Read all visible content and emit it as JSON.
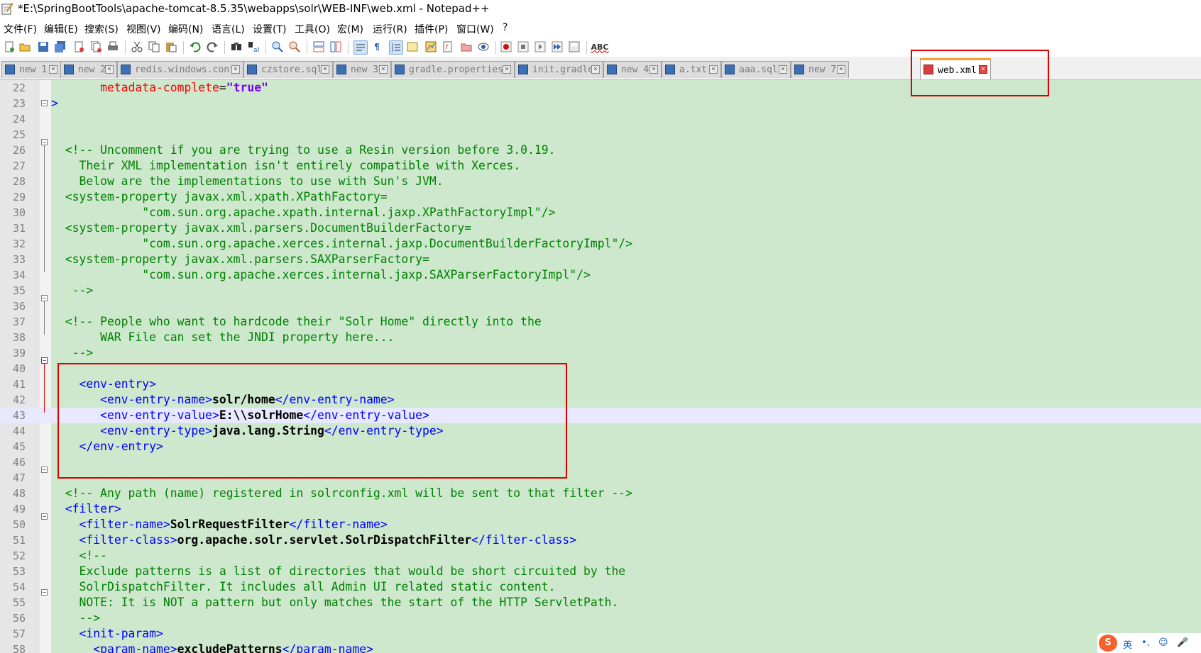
{
  "window": {
    "title": "*E:\\SpringBootTools\\apache-tomcat-8.5.35\\webapps\\solr\\WEB-INF\\web.xml - Notepad++"
  },
  "menu": [
    "文件(F)",
    "编辑(E)",
    "搜索(S)",
    "视图(V)",
    "编码(N)",
    "语言(L)",
    "设置(T)",
    "工具(O)",
    "宏(M)",
    "运行(R)",
    "插件(P)",
    "窗口(W)",
    "?"
  ],
  "toolbar": {
    "icons": [
      "new-file-icon",
      "open-file-icon",
      "save-icon",
      "save-all-icon",
      "close-icon",
      "close-all-icon",
      "print-icon",
      "cut-icon",
      "copy-icon",
      "paste-icon",
      "undo-icon",
      "redo-icon",
      "find-icon",
      "replace-icon",
      "zoom-in-icon",
      "zoom-out-icon",
      "sync-vertical-icon",
      "sync-horizontal-icon",
      "word-wrap-icon",
      "show-all-chars-icon",
      "indent-guide-icon",
      "user-language-icon",
      "document-map-icon",
      "function-list-icon",
      "folder-workspace-icon",
      "monitoring-icon",
      "record-macro-icon",
      "stop-macro-icon",
      "play-macro-icon",
      "run-macro-multiple-icon",
      "save-macro-icon",
      "spell-check-icon"
    ],
    "spell_label": "ABC"
  },
  "tabs": [
    {
      "label": "new 1"
    },
    {
      "label": "new 2"
    },
    {
      "label": "redis.windows.conf"
    },
    {
      "label": "czstore.sql"
    },
    {
      "label": "new 3"
    },
    {
      "label": "gradle.properties"
    },
    {
      "label": "init.gradle"
    },
    {
      "label": "new 4"
    },
    {
      "label": "a.txt"
    },
    {
      "label": "aaa.sql"
    },
    {
      "label": "new 7"
    },
    {
      "label": "web.xml",
      "active": true
    }
  ],
  "editor": {
    "current_line": 43,
    "lines": [
      {
        "n": "22",
        "parts": [
          [
            "",
            "       "
          ],
          [
            "attr",
            "metadata-complete"
          ],
          [
            "",
            "="
          ],
          [
            "aval",
            "\"true\""
          ]
        ]
      },
      {
        "n": "23",
        "parts": [
          [
            "tag",
            ">"
          ]
        ]
      },
      {
        "n": "24",
        "parts": []
      },
      {
        "n": "25",
        "parts": []
      },
      {
        "n": "26",
        "parts": [
          [
            "cmt",
            "  <!-- Uncomment if you are trying to use a Resin version before 3.0.19."
          ]
        ]
      },
      {
        "n": "27",
        "parts": [
          [
            "cmt",
            "    Their XML implementation isn't entirely compatible with Xerces."
          ]
        ]
      },
      {
        "n": "28",
        "parts": [
          [
            "cmt",
            "    Below are the implementations to use with Sun's JVM."
          ]
        ]
      },
      {
        "n": "29",
        "parts": [
          [
            "cmt",
            "  <system-property javax.xml.xpath.XPathFactory="
          ]
        ]
      },
      {
        "n": "30",
        "parts": [
          [
            "cmt",
            "             \"com.sun.org.apache.xpath.internal.jaxp.XPathFactoryImpl\"/>"
          ]
        ]
      },
      {
        "n": "31",
        "parts": [
          [
            "cmt",
            "  <system-property javax.xml.parsers.DocumentBuilderFactory="
          ]
        ]
      },
      {
        "n": "32",
        "parts": [
          [
            "cmt",
            "             \"com.sun.org.apache.xerces.internal.jaxp.DocumentBuilderFactoryImpl\"/>"
          ]
        ]
      },
      {
        "n": "33",
        "parts": [
          [
            "cmt",
            "  <system-property javax.xml.parsers.SAXParserFactory="
          ]
        ]
      },
      {
        "n": "34",
        "parts": [
          [
            "cmt",
            "             \"com.sun.org.apache.xerces.internal.jaxp.SAXParserFactoryImpl\"/>"
          ]
        ]
      },
      {
        "n": "35",
        "parts": [
          [
            "cmt",
            "   -->"
          ]
        ]
      },
      {
        "n": "36",
        "parts": []
      },
      {
        "n": "37",
        "parts": [
          [
            "cmt",
            "  <!-- People who want to hardcode their \"Solr Home\" directly into the"
          ]
        ]
      },
      {
        "n": "38",
        "parts": [
          [
            "cmt",
            "       WAR File can set the JNDI property here..."
          ]
        ]
      },
      {
        "n": "39",
        "parts": [
          [
            "cmt",
            "   -->"
          ]
        ]
      },
      {
        "n": "40",
        "parts": []
      },
      {
        "n": "41",
        "parts": [
          [
            "",
            "    "
          ],
          [
            "tag",
            "<env-entry>"
          ]
        ]
      },
      {
        "n": "42",
        "parts": [
          [
            "",
            "       "
          ],
          [
            "tag",
            "<env-entry-name>"
          ],
          [
            "txt",
            "solr/home"
          ],
          [
            "tag",
            "</env-entry-name>"
          ]
        ]
      },
      {
        "n": "43",
        "parts": [
          [
            "",
            "       "
          ],
          [
            "tag",
            "<env-entry-value>"
          ],
          [
            "txt",
            "E:\\\\solrHome"
          ],
          [
            "tag",
            "</env-entry-value>"
          ]
        ]
      },
      {
        "n": "44",
        "parts": [
          [
            "",
            "       "
          ],
          [
            "tag",
            "<env-entry-type>"
          ],
          [
            "txt",
            "java.lang.String"
          ],
          [
            "tag",
            "</env-entry-type>"
          ]
        ]
      },
      {
        "n": "45",
        "parts": [
          [
            "",
            "    "
          ],
          [
            "tag",
            "</env-entry>"
          ]
        ]
      },
      {
        "n": "46",
        "parts": []
      },
      {
        "n": "47",
        "parts": []
      },
      {
        "n": "48",
        "parts": [
          [
            "cmt",
            "  <!-- Any path (name) registered in solrconfig.xml will be sent to that filter -->"
          ]
        ]
      },
      {
        "n": "49",
        "parts": [
          [
            "",
            "  "
          ],
          [
            "tag",
            "<filter>"
          ]
        ]
      },
      {
        "n": "50",
        "parts": [
          [
            "",
            "    "
          ],
          [
            "tag",
            "<filter-name>"
          ],
          [
            "txt",
            "SolrRequestFilter"
          ],
          [
            "tag",
            "</filter-name>"
          ]
        ]
      },
      {
        "n": "51",
        "parts": [
          [
            "",
            "    "
          ],
          [
            "tag",
            "<filter-class>"
          ],
          [
            "txt",
            "org.apache.solr.servlet.SolrDispatchFilter"
          ],
          [
            "tag",
            "</filter-class>"
          ]
        ]
      },
      {
        "n": "52",
        "parts": [
          [
            "cmt",
            "    <!--"
          ]
        ]
      },
      {
        "n": "53",
        "parts": [
          [
            "cmt",
            "    Exclude patterns is a list of directories that would be short circuited by the"
          ]
        ]
      },
      {
        "n": "54",
        "parts": [
          [
            "cmt",
            "    SolrDispatchFilter. It includes all Admin UI related static content."
          ]
        ]
      },
      {
        "n": "55",
        "parts": [
          [
            "cmt",
            "    NOTE: It is NOT a pattern but only matches the start of the HTTP ServletPath."
          ]
        ]
      },
      {
        "n": "56",
        "parts": [
          [
            "cmt",
            "    -->"
          ]
        ]
      },
      {
        "n": "57",
        "parts": [
          [
            "",
            "    "
          ],
          [
            "tag",
            "<init-param>"
          ]
        ]
      },
      {
        "n": "58",
        "parts": [
          [
            "",
            "      "
          ],
          [
            "tag",
            "<param-name>"
          ],
          [
            "txt",
            "excludePatterns"
          ],
          [
            "tag",
            "</param-name>"
          ]
        ]
      }
    ]
  },
  "ime": {
    "logo": "S",
    "mode": "英",
    "punct": "•,",
    "emoji": "☺",
    "mic": "🎤"
  },
  "colors": {
    "editor_bg": "#cde8cd",
    "highlight_box": "#e00000",
    "comment": "#008000",
    "tag": "#0000ff"
  }
}
